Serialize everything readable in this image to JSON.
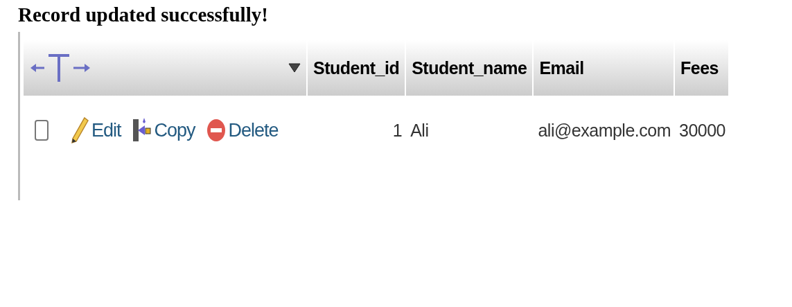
{
  "message": "Record updated successfully!",
  "table": {
    "columns": [
      "Student_id",
      "Student_name",
      "Email",
      "Fees"
    ],
    "rows": [
      {
        "checked": false,
        "actions": [
          {
            "kind": "edit",
            "label": "Edit"
          },
          {
            "kind": "copy",
            "label": "Copy"
          },
          {
            "kind": "delete",
            "label": "Delete"
          }
        ],
        "cells": [
          "1",
          "Ali",
          "ali@example.com",
          "30000"
        ]
      }
    ]
  }
}
